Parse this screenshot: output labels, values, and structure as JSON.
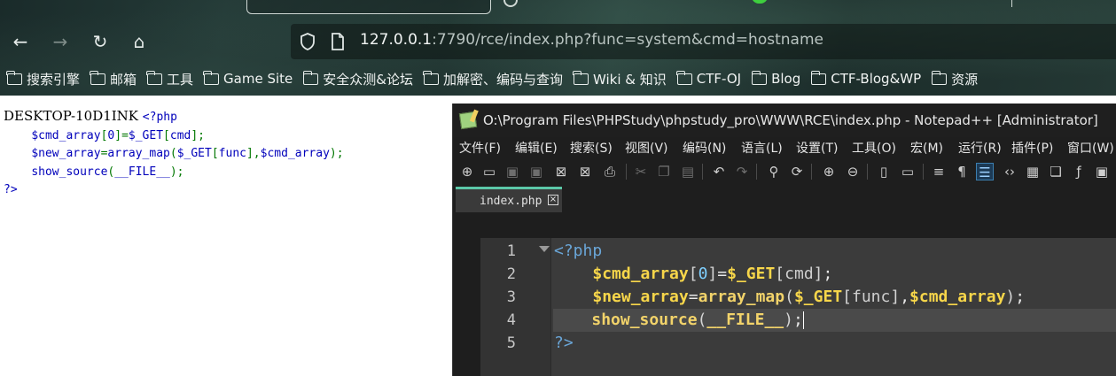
{
  "browser": {
    "nav": {
      "back_icon": "←",
      "forward_icon": "→",
      "reload_icon": "↻",
      "home_icon": "⌂"
    },
    "url": {
      "host": "127.0.0.1",
      "rest": ":7790/rce/index.php?func=system&cmd=hostname"
    },
    "bookmarks": [
      "搜索引擎",
      "邮箱",
      "工具",
      "Game Site",
      "安全众测&论坛",
      "加解密、编码与查询",
      "Wiki & 知识",
      "CTF-OJ",
      "Blog",
      "CTF-Blog&WP",
      "资源"
    ]
  },
  "page": {
    "output": "DESKTOP-10D1INK",
    "source_lines": [
      [
        {
          "t": "<?php",
          "c": "def"
        }
      ],
      [
        {
          "t": "    ",
          "c": "def"
        },
        {
          "t": "$cmd_array",
          "c": "def"
        },
        {
          "t": "[",
          "c": "kw"
        },
        {
          "t": "0",
          "c": "def"
        },
        {
          "t": "]=",
          "c": "kw"
        },
        {
          "t": "$_GET",
          "c": "def"
        },
        {
          "t": "[",
          "c": "kw"
        },
        {
          "t": "cmd",
          "c": "def"
        },
        {
          "t": "];",
          "c": "kw"
        }
      ],
      [
        {
          "t": "    ",
          "c": "def"
        },
        {
          "t": "$new_array",
          "c": "def"
        },
        {
          "t": "=",
          "c": "kw"
        },
        {
          "t": "array_map",
          "c": "def"
        },
        {
          "t": "(",
          "c": "kw"
        },
        {
          "t": "$_GET",
          "c": "def"
        },
        {
          "t": "[",
          "c": "kw"
        },
        {
          "t": "func",
          "c": "def"
        },
        {
          "t": "],",
          "c": "kw"
        },
        {
          "t": "$cmd_array",
          "c": "def"
        },
        {
          "t": ");",
          "c": "kw"
        }
      ],
      [
        {
          "t": "    ",
          "c": "def"
        },
        {
          "t": "show_source",
          "c": "def"
        },
        {
          "t": "(",
          "c": "kw"
        },
        {
          "t": "__FILE__",
          "c": "def"
        },
        {
          "t": ");",
          "c": "kw"
        }
      ],
      [
        {
          "t": "?>",
          "c": "def"
        }
      ]
    ]
  },
  "notepad": {
    "title": "O:\\Program Files\\PHPStudy\\phpstudy_pro\\WWW\\RCE\\index.php - Notepad++ [Administrator]",
    "menu": [
      "文件(F)",
      "编辑(E)",
      "搜索(S)",
      "视图(V)",
      "编码(N)",
      "语言(L)",
      "设置(T)",
      "工具(O)",
      "宏(M)",
      "运行(R)",
      "插件(P)",
      "窗口(W)"
    ],
    "tab_label": "index.php",
    "tab_close_icon": "×",
    "line_numbers": [
      "1",
      "2",
      "3",
      "4",
      "5"
    ],
    "code_lines": [
      [
        {
          "t": "<?php",
          "c": "php"
        }
      ],
      [
        {
          "t": "    ",
          "c": "op"
        },
        {
          "t": "$cmd_array",
          "c": "var"
        },
        {
          "t": "[",
          "c": "br"
        },
        {
          "t": "0",
          "c": "num"
        },
        {
          "t": "]",
          "c": "br"
        },
        {
          "t": "=",
          "c": "op"
        },
        {
          "t": "$_GET",
          "c": "var"
        },
        {
          "t": "[",
          "c": "br"
        },
        {
          "t": "cmd",
          "c": "str"
        },
        {
          "t": "]",
          "c": "br"
        },
        {
          "t": ";",
          "c": "op"
        }
      ],
      [
        {
          "t": "    ",
          "c": "op"
        },
        {
          "t": "$new_array",
          "c": "var"
        },
        {
          "t": "=",
          "c": "op"
        },
        {
          "t": "array_map",
          "c": "fn"
        },
        {
          "t": "(",
          "c": "br"
        },
        {
          "t": "$_GET",
          "c": "var"
        },
        {
          "t": "[",
          "c": "br"
        },
        {
          "t": "func",
          "c": "str"
        },
        {
          "t": "]",
          "c": "br"
        },
        {
          "t": ",",
          "c": "op"
        },
        {
          "t": "$cmd_array",
          "c": "var"
        },
        {
          "t": ")",
          "c": "br"
        },
        {
          "t": ";",
          "c": "op"
        }
      ],
      [
        {
          "t": "    ",
          "c": "op"
        },
        {
          "t": "show_source",
          "c": "fn"
        },
        {
          "t": "(",
          "c": "br"
        },
        {
          "t": "__FILE__",
          "c": "fn"
        },
        {
          "t": ")",
          "c": "br"
        },
        {
          "t": ";",
          "c": "op"
        }
      ],
      [
        {
          "t": "?>",
          "c": "php"
        }
      ]
    ],
    "current_line": 4
  },
  "colors": {
    "php_source_default": "#0000bb",
    "php_source_keyword": "#007700",
    "tab_accent": "#5cc8a8"
  }
}
